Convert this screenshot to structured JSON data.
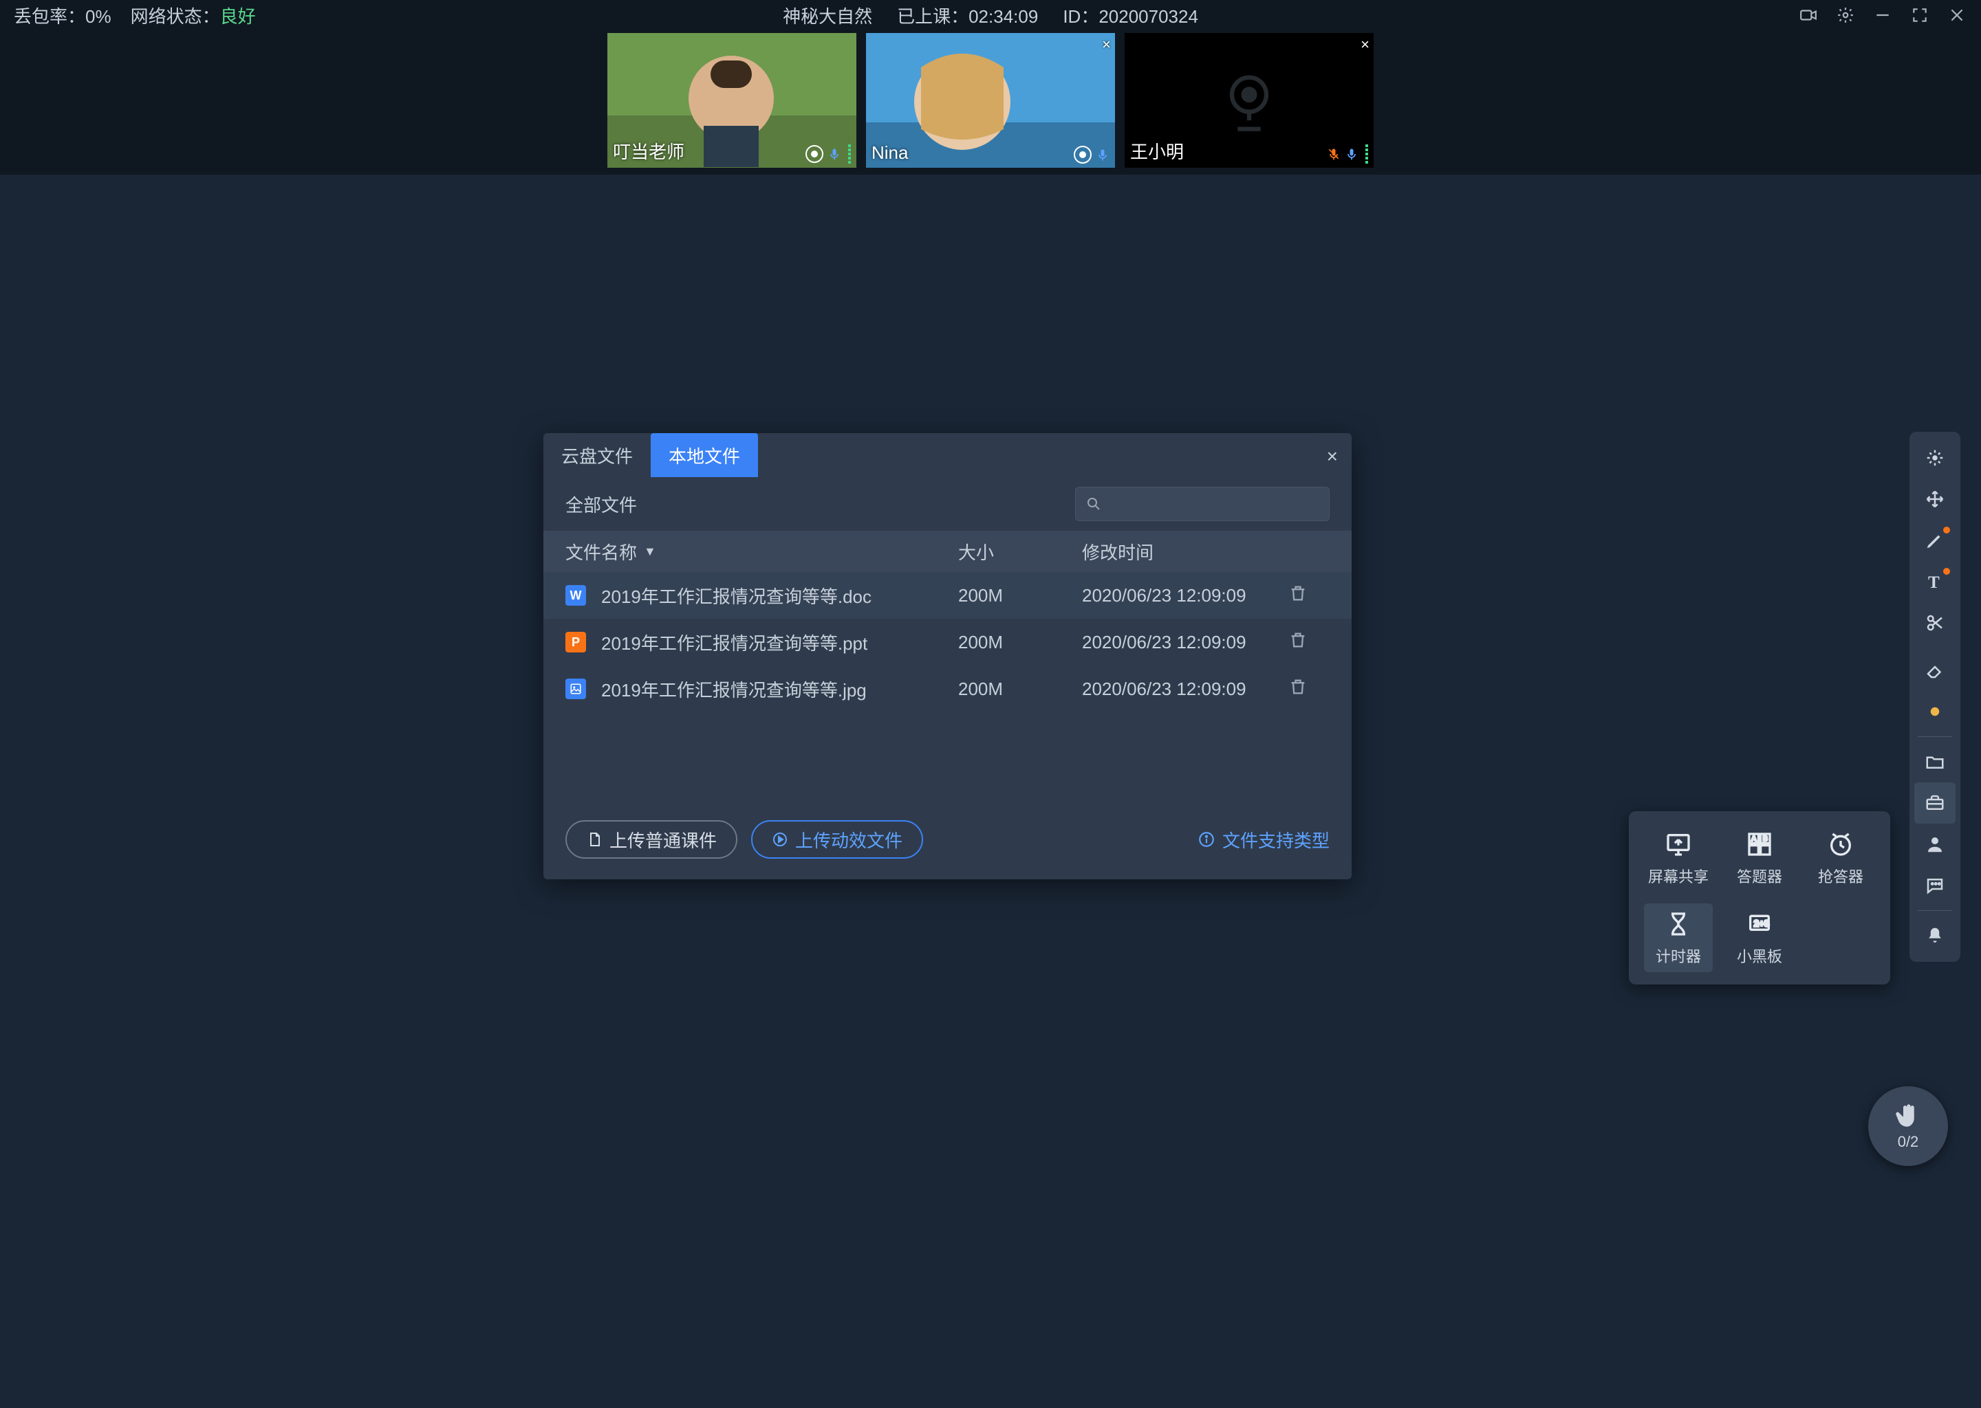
{
  "topbar": {
    "loss_label": "丢包率：",
    "loss_value": "0%",
    "net_label": "网络状态：",
    "net_value": "良好",
    "course_name": "神秘大自然",
    "duration_label": "已上课：",
    "duration_value": "02:34:09",
    "id_label": "ID：",
    "id_value": "2020070324"
  },
  "participants": [
    {
      "name": "叮当老师",
      "camera": true,
      "muted": false,
      "closable": false,
      "face_colors": [
        "#8bb86f",
        "#c89b75"
      ]
    },
    {
      "name": "Nina",
      "camera": true,
      "muted": false,
      "closable": true,
      "face_colors": [
        "#6aa8e8",
        "#e8c48a"
      ]
    },
    {
      "name": "王小明",
      "camera": false,
      "muted": true,
      "closable": true,
      "face_colors": [
        "#000",
        "#000"
      ]
    }
  ],
  "dialog": {
    "tabs": [
      "云盘文件",
      "本地文件"
    ],
    "active_tab": 1,
    "filter_label": "全部文件",
    "columns": {
      "name": "文件名称",
      "size": "大小",
      "time": "修改时间"
    },
    "files": [
      {
        "type": "doc",
        "name": "2019年工作汇报情况查询等等.doc",
        "size": "200M",
        "time": "2020/06/23 12:09:09"
      },
      {
        "type": "ppt",
        "name": "2019年工作汇报情况查询等等.ppt",
        "size": "200M",
        "time": "2020/06/23 12:09:09"
      },
      {
        "type": "jpg",
        "name": "2019年工作汇报情况查询等等.jpg",
        "size": "200M",
        "time": "2020/06/23 12:09:09"
      }
    ],
    "upload_normal": "上传普通课件",
    "upload_anim": "上传动效文件",
    "support_link": "文件支持类型"
  },
  "toolbar": {
    "items": [
      "laser",
      "move",
      "pen",
      "text",
      "scissors",
      "eraser",
      "dot",
      "folder",
      "toolbox",
      "user",
      "chat",
      "bell"
    ]
  },
  "tools_popup": [
    {
      "label": "屏幕共享",
      "icon": "screen"
    },
    {
      "label": "答题器",
      "icon": "quiz"
    },
    {
      "label": "抢答器",
      "icon": "alarm"
    },
    {
      "label": "计时器",
      "icon": "timer",
      "highlight": true
    },
    {
      "label": "小黑板",
      "icon": "board"
    }
  ],
  "hand": {
    "count": "0/2"
  }
}
